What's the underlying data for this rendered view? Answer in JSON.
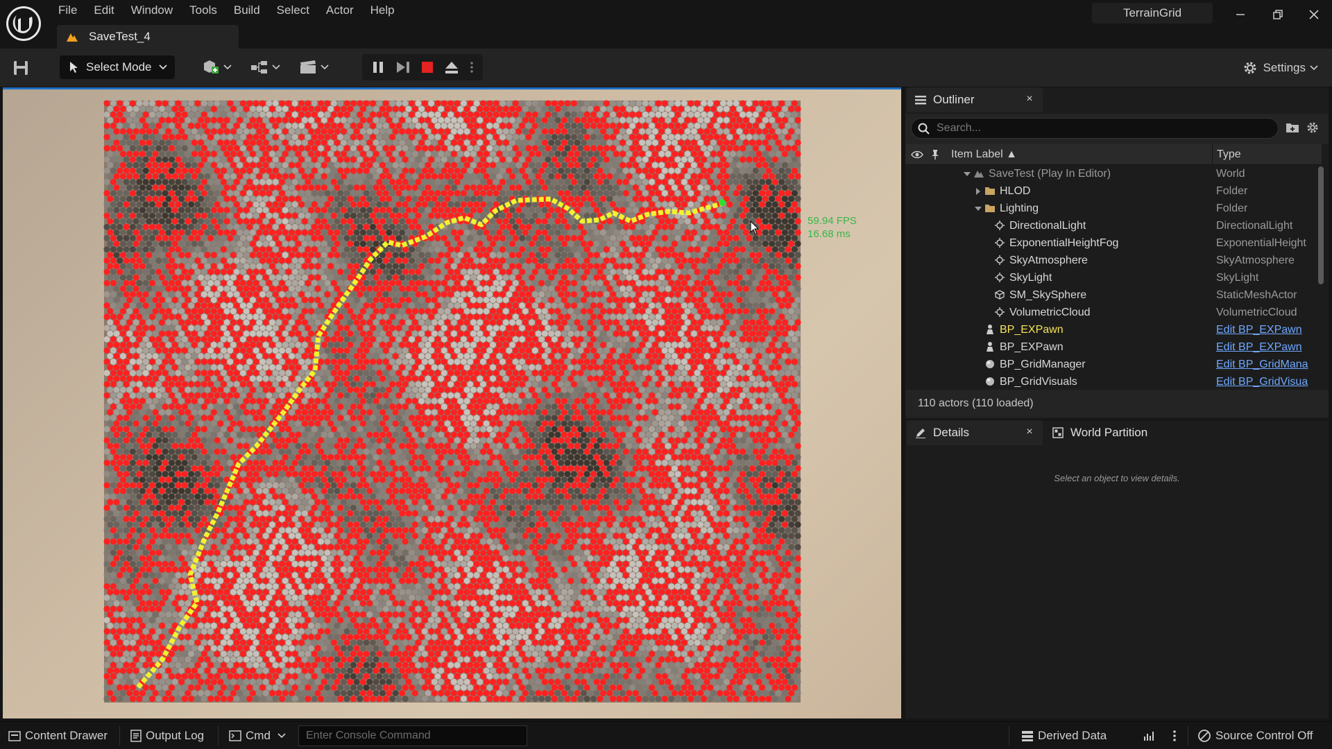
{
  "menu": [
    "File",
    "Edit",
    "Window",
    "Tools",
    "Build",
    "Select",
    "Actor",
    "Help"
  ],
  "level_tab": "SaveTest_4",
  "project_name": "TerrainGrid",
  "toolbar": {
    "select_mode": "Select Mode",
    "settings": "Settings"
  },
  "viewport": {
    "fps": "59.94 FPS",
    "ms": "16.68 ms",
    "colors": {
      "blocked": "#ff2020",
      "path": "#f2f230",
      "goal": "#30e030"
    }
  },
  "outliner": {
    "tab": "Outliner",
    "close": "×",
    "search_placeholder": "Search...",
    "col_label": "Item Label ▲",
    "col_type": "Type",
    "rows": [
      {
        "label": "SaveTest (Play In Editor)",
        "type": "World",
        "icon": "world-icon"
      },
      {
        "label": "HLOD",
        "type": "Folder",
        "icon": "folder-icon"
      },
      {
        "label": "Lighting",
        "type": "Folder",
        "icon": "folder-open-icon"
      },
      {
        "label": "DirectionalLight",
        "type": "DirectionalLight",
        "icon": "sun-icon"
      },
      {
        "label": "ExponentialHeightFog",
        "type": "ExponentialHeight",
        "icon": "fog-icon"
      },
      {
        "label": "SkyAtmosphere",
        "type": "SkyAtmosphere",
        "icon": "atmosphere-icon"
      },
      {
        "label": "SkyLight",
        "type": "SkyLight",
        "icon": "skylight-icon"
      },
      {
        "label": "SM_SkySphere",
        "type": "StaticMeshActor",
        "icon": "mesh-icon"
      },
      {
        "label": "VolumetricCloud",
        "type": "VolumetricCloud",
        "icon": "cloud-icon"
      },
      {
        "label": "BP_EXPawn",
        "type": "Edit BP_EXPawn",
        "icon": "pawn-icon"
      },
      {
        "label": "BP_EXPawn",
        "type": "Edit BP_EXPawn",
        "icon": "pawn-icon"
      },
      {
        "label": "BP_GridManager",
        "type": "Edit BP_GridMana",
        "icon": "actor-icon"
      },
      {
        "label": "BP_GridVisuals",
        "type": "Edit BP_GridVisua",
        "icon": "actor-icon"
      }
    ],
    "footer": "110 actors (110 loaded)"
  },
  "details": {
    "tab": "Details",
    "close": "×",
    "tab2": "World Partition",
    "empty": "Select an object to view details."
  },
  "statusbar": {
    "content_drawer": "Content Drawer",
    "output_log": "Output Log",
    "cmd": "Cmd",
    "console_placeholder": "Enter Console Command",
    "derived_data": "Derived Data",
    "source_control": "Source Control Off"
  }
}
